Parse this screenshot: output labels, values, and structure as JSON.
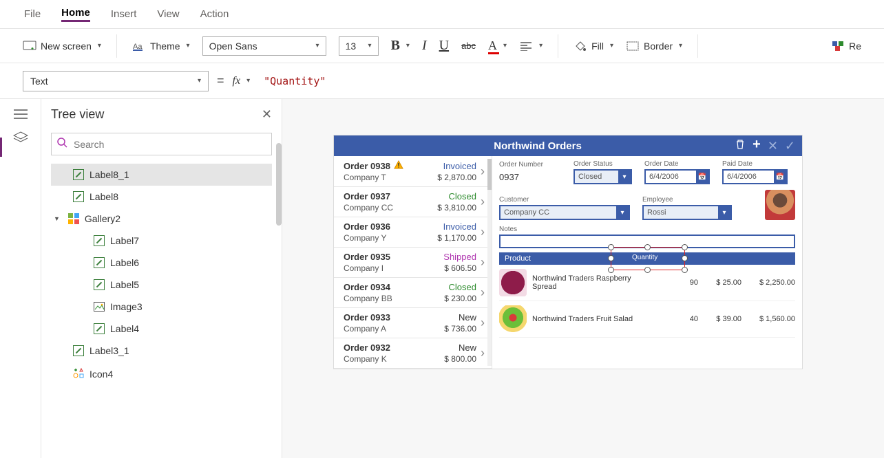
{
  "menu": {
    "file": "File",
    "home": "Home",
    "insert": "Insert",
    "view": "View",
    "action": "Action"
  },
  "toolbar": {
    "new_screen": "New screen",
    "theme": "Theme",
    "font": "Open Sans",
    "size": "13",
    "fill": "Fill",
    "border": "Border",
    "reorder": "Re"
  },
  "fx": {
    "property": "Text",
    "value": "\"Quantity\""
  },
  "tree": {
    "title": "Tree view",
    "search_ph": "Search",
    "items": [
      {
        "name": "Label8_1",
        "icon": "label",
        "indent": 1,
        "sel": true
      },
      {
        "name": "Label8",
        "icon": "label",
        "indent": 1
      },
      {
        "name": "Gallery2",
        "icon": "gallery",
        "indent": 0,
        "caret": true
      },
      {
        "name": "Label7",
        "icon": "label",
        "indent": 2
      },
      {
        "name": "Label6",
        "icon": "label",
        "indent": 2
      },
      {
        "name": "Label5",
        "icon": "label",
        "indent": 2
      },
      {
        "name": "Image3",
        "icon": "image",
        "indent": 2
      },
      {
        "name": "Label4",
        "icon": "label",
        "indent": 2
      },
      {
        "name": "Label3_1",
        "icon": "label",
        "indent": 1
      },
      {
        "name": "Icon4",
        "icon": "iconctrl",
        "indent": 1
      }
    ]
  },
  "app": {
    "title": "Northwind Orders",
    "orders": [
      {
        "name": "Order 0938",
        "company": "Company T",
        "status": "Invoiced",
        "statusCls": "invoiced",
        "amount": "$ 2,870.00",
        "warn": true
      },
      {
        "name": "Order 0937",
        "company": "Company CC",
        "status": "Closed",
        "statusCls": "closed",
        "amount": "$ 3,810.00"
      },
      {
        "name": "Order 0936",
        "company": "Company Y",
        "status": "Invoiced",
        "statusCls": "invoiced",
        "amount": "$ 1,170.00"
      },
      {
        "name": "Order 0935",
        "company": "Company I",
        "status": "Shipped",
        "statusCls": "shipped",
        "amount": "$ 606.50"
      },
      {
        "name": "Order 0934",
        "company": "Company BB",
        "status": "Closed",
        "statusCls": "closed",
        "amount": "$ 230.00"
      },
      {
        "name": "Order 0933",
        "company": "Company A",
        "status": "New",
        "statusCls": "new",
        "amount": "$ 736.00"
      },
      {
        "name": "Order 0932",
        "company": "Company K",
        "status": "New",
        "statusCls": "new",
        "amount": "$ 800.00"
      }
    ],
    "detail": {
      "labels": {
        "orderno": "Order Number",
        "status": "Order Status",
        "orderdate": "Order Date",
        "paiddate": "Paid Date",
        "customer": "Customer",
        "employee": "Employee",
        "notes": "Notes"
      },
      "orderno": "0937",
      "status": "Closed",
      "orderdate": "6/4/2006",
      "paiddate": "6/4/2006",
      "customer": "Company CC",
      "employee": "Rossi",
      "product_hdr": "Product",
      "qty_hdr": "Quantity"
    },
    "products": [
      {
        "name": "Northwind Traders Raspberry Spread",
        "qty": "90",
        "price": "$ 25.00",
        "total": "$ 2,250.00",
        "img": "rasp"
      },
      {
        "name": "Northwind Traders Fruit Salad",
        "qty": "40",
        "price": "$ 39.00",
        "total": "$ 1,560.00",
        "img": "salad"
      }
    ]
  }
}
